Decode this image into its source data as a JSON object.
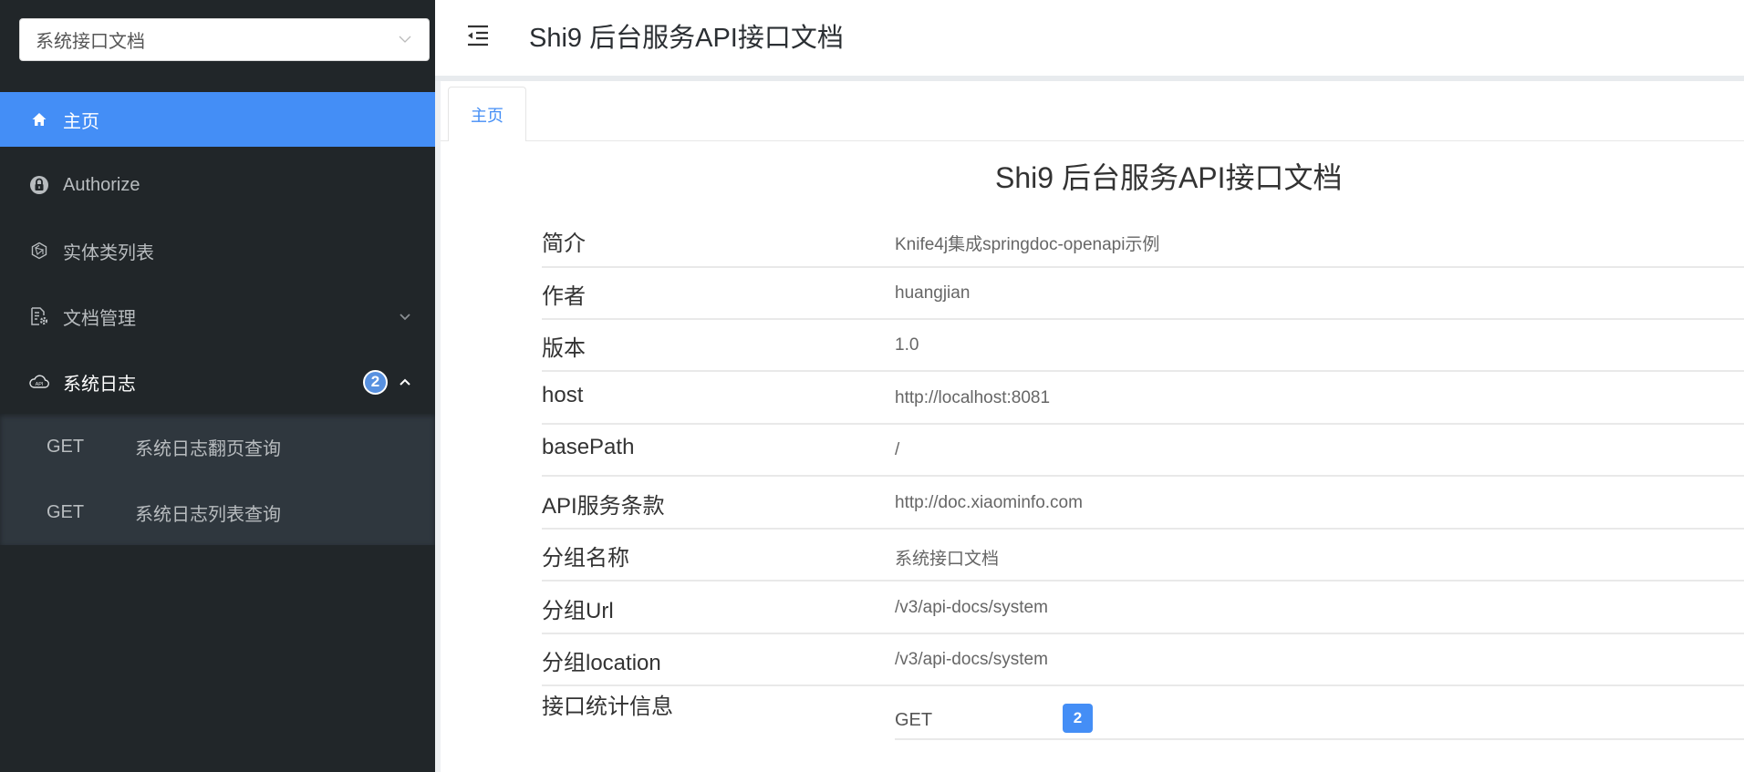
{
  "sidebar": {
    "group_select": {
      "value": "系统接口文档"
    },
    "menu": [
      {
        "label": "主页",
        "icon": "home-icon",
        "active": true
      },
      {
        "label": "Authorize",
        "icon": "lock-icon"
      },
      {
        "label": "实体类列表",
        "icon": "model-icon"
      },
      {
        "label": "文档管理",
        "icon": "doc-settings-icon",
        "expand": "chevron-down-icon"
      },
      {
        "label": "系统日志",
        "icon": "cloud-api-icon",
        "count": "2",
        "expand": "chevron-up-icon"
      }
    ],
    "submenu": [
      {
        "method": "GET",
        "name": "系统日志翻页查询"
      },
      {
        "method": "GET",
        "name": "系统日志列表查询"
      }
    ]
  },
  "header": {
    "title": "Shi9 后台服务API接口文档"
  },
  "tabs": [
    {
      "label": "主页",
      "active": true
    }
  ],
  "main": {
    "title": "Shi9 后台服务API接口文档",
    "rows": [
      {
        "key": "简介",
        "value": "Knife4j集成springdoc-openapi示例"
      },
      {
        "key": "作者",
        "value": "huangjian"
      },
      {
        "key": "版本",
        "value": "1.0"
      },
      {
        "key": "host",
        "value": "http://localhost:8081"
      },
      {
        "key": "basePath",
        "value": "/"
      },
      {
        "key": "API服务条款",
        "value": "http://doc.xiaominfo.com"
      },
      {
        "key": "分组名称",
        "value": "系统接口文档"
      },
      {
        "key": "分组Url",
        "value": "/v3/api-docs/system"
      },
      {
        "key": "分组location",
        "value": "/v3/api-docs/system"
      }
    ],
    "stats": {
      "key": "接口统计信息",
      "method": "GET",
      "count": "2"
    }
  },
  "colors": {
    "accent": "#448ef6",
    "sidebar_bg": "#212629",
    "submenu_bg": "#2f373e"
  }
}
